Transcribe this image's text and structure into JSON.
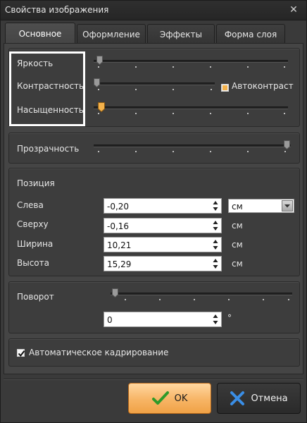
{
  "window": {
    "title": "Свойства изображения",
    "close_glyph": "✕"
  },
  "tabs": [
    {
      "label": "Основное",
      "active": true
    },
    {
      "label": "Оформление",
      "active": false
    },
    {
      "label": "Эффекты",
      "active": false
    },
    {
      "label": "Форма слоя",
      "active": false
    }
  ],
  "adjustments": {
    "brightness_label": "Яркость",
    "contrast_label": "Контрастность",
    "saturation_label": "Насыщенность",
    "auto_contrast_label": "Автоконтраст",
    "auto_contrast_checked": true
  },
  "transparency": {
    "label": "Прозрачность"
  },
  "position": {
    "title": "Позиция",
    "left_label": "Слева",
    "left_value": "-0,20",
    "top_label": "Сверху",
    "top_value": "-0,16",
    "width_label": "Ширина",
    "width_value": "10,21",
    "height_label": "Высота",
    "height_value": "15,29",
    "unit_selected": "см",
    "unit": "см"
  },
  "rotation": {
    "label": "Поворот",
    "value": "0",
    "unit": "°"
  },
  "auto_crop": {
    "label": "Автоматическое кадрирование",
    "checked": true
  },
  "buttons": {
    "ok_label": "OK",
    "cancel_label": "Отмена"
  },
  "colors": {
    "accent": "#f3b14b",
    "ok_bg": "#f7b465",
    "cancel_icon": "#3a8ee6"
  }
}
